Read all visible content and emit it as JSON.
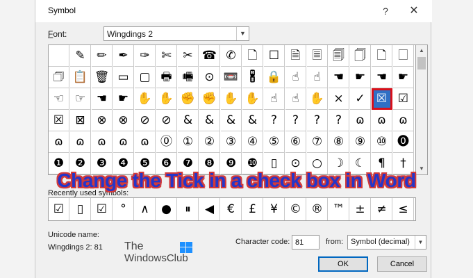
{
  "dialog": {
    "title": "Symbol",
    "help_label": "?",
    "close_label": "✕"
  },
  "font": {
    "label_prefix": "",
    "label_accel": "F",
    "label_rest": "ont:",
    "value": "Wingdings 2"
  },
  "symbol_grid": {
    "rows": [
      [
        "",
        "✎",
        "✏",
        "✒",
        "✑",
        "✄",
        "✂",
        "☎",
        "✆",
        "🗋",
        "☐",
        "🗎",
        "🗏",
        "🗐",
        "🗍",
        "🗋",
        "🗌"
      ],
      [
        "🗇",
        "📋",
        "🗑",
        "▭",
        "▢",
        "🖶",
        "🖷",
        "⊙",
        "📼",
        "🖁",
        "🔒",
        "☝",
        "☝",
        "☚",
        "☛",
        "☚",
        "☛"
      ],
      [
        "☜",
        "☞",
        "☚",
        "☛",
        "✋",
        "✋",
        "✊",
        "✊",
        "✋",
        "✋",
        "☝",
        "☝",
        "✋",
        "×",
        "✓",
        "☒",
        "☑"
      ],
      [
        "☒",
        "⊠",
        "⊗",
        "⊗",
        "⊘",
        "⊘",
        "&",
        "&",
        "&",
        "&",
        "?",
        "?",
        "?",
        "?",
        "ɷ",
        "ɷ",
        "ɷ"
      ],
      [
        "ɷ",
        "ɷ",
        "ɷ",
        "ɷ",
        "ɷ",
        "⓪",
        "①",
        "②",
        "③",
        "④",
        "⑤",
        "⑥",
        "⑦",
        "⑧",
        "⑨",
        "⑩",
        "⓿"
      ],
      [
        "❶",
        "❷",
        "❸",
        "❹",
        "❺",
        "❻",
        "❼",
        "❽",
        "❾",
        "❿",
        "▯",
        "⊙",
        "○",
        "☽",
        "☾",
        "¶",
        "†"
      ]
    ],
    "selected_row": 2,
    "selected_col": 15
  },
  "recent": {
    "label": "Recently used symbols:",
    "items": [
      "☑",
      "▯",
      "☑",
      "°",
      "∧",
      "●",
      "⏸",
      "◀",
      "€",
      "£",
      "¥",
      "©",
      "®",
      "™",
      "±",
      "≠",
      "≤"
    ]
  },
  "unicode": {
    "label": "Unicode name:",
    "value": "Wingdings 2: 81"
  },
  "logo": {
    "line1": "The",
    "line2": "WindowsClub"
  },
  "character_code": {
    "label": "Character code:",
    "value": "81"
  },
  "from": {
    "label": "from:",
    "value": "Symbol (decimal)"
  },
  "buttons": {
    "ok": "OK",
    "cancel": "Cancel"
  },
  "overlay": {
    "text": "Change the Tick in a check box in Word"
  }
}
